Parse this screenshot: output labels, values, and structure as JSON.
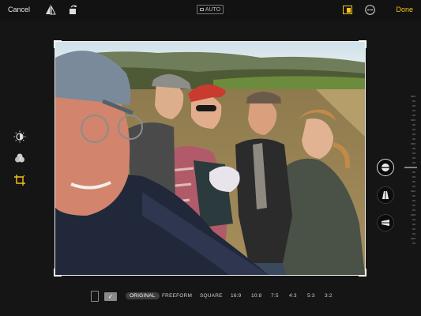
{
  "toolbar": {
    "cancel_label": "Cancel",
    "auto_label": "AUTO",
    "done_label": "Done",
    "accent_color": "#f5c518",
    "icons": [
      "flip-horizontal-icon",
      "rotate-icon",
      "aspect-ratio-icon",
      "more-options-icon"
    ]
  },
  "side_tools": {
    "icons": [
      "adjust-icon",
      "filters-icon",
      "crop-icon"
    ],
    "active": "crop-icon"
  },
  "straighten_controls": {
    "icons": [
      "straighten-icon",
      "vertical-perspective-icon",
      "horizontal-perspective-icon"
    ],
    "active": "straighten-icon"
  },
  "aspect_bar": {
    "orientation_icons": [
      "portrait-orientation-icon",
      "landscape-orientation-icon"
    ],
    "selected_orientation": "landscape-orientation-icon",
    "options": [
      "ORIGINAL",
      "FREEFORM",
      "SQUARE",
      "16:9",
      "10:8",
      "7:5",
      "4:3",
      "5:3",
      "3:2"
    ],
    "selected": "ORIGINAL"
  }
}
